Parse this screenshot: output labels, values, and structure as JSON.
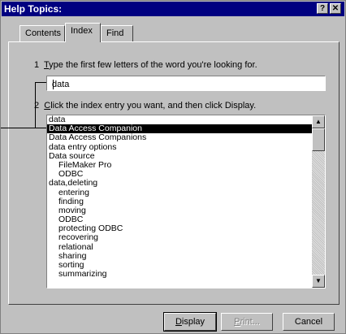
{
  "window": {
    "title": "Help Topics:"
  },
  "titlebar_buttons": {
    "help": "?",
    "close": "✕"
  },
  "tabs": [
    {
      "label": "Contents"
    },
    {
      "label": "Index"
    },
    {
      "label": "Find"
    }
  ],
  "step1": {
    "number": "1",
    "underlined_char": "T",
    "rest": "ype the first few letters of the word you're looking for."
  },
  "search": {
    "value": "data"
  },
  "step2": {
    "number": "2",
    "underlined_char": "C",
    "rest": "lick the index entry you want, and then click Display."
  },
  "index_list": [
    {
      "text": "data",
      "sub": false,
      "selected": false
    },
    {
      "text": "Data Access Companion",
      "sub": false,
      "selected": true
    },
    {
      "text": "Data Access Companions",
      "sub": false,
      "selected": false
    },
    {
      "text": "data entry options",
      "sub": false,
      "selected": false
    },
    {
      "text": "Data source",
      "sub": false,
      "selected": false
    },
    {
      "text": "FileMaker Pro",
      "sub": true,
      "selected": false
    },
    {
      "text": "ODBC",
      "sub": true,
      "selected": false
    },
    {
      "text": "data,deleting",
      "sub": false,
      "selected": false
    },
    {
      "text": "entering",
      "sub": true,
      "selected": false
    },
    {
      "text": "finding",
      "sub": true,
      "selected": false
    },
    {
      "text": "moving",
      "sub": true,
      "selected": false
    },
    {
      "text": "ODBC",
      "sub": true,
      "selected": false
    },
    {
      "text": "protecting ODBC",
      "sub": true,
      "selected": false
    },
    {
      "text": "recovering",
      "sub": true,
      "selected": false
    },
    {
      "text": "relational",
      "sub": true,
      "selected": false
    },
    {
      "text": "sharing",
      "sub": true,
      "selected": false
    },
    {
      "text": "sorting",
      "sub": true,
      "selected": false
    },
    {
      "text": "summarizing",
      "sub": true,
      "selected": false
    }
  ],
  "buttons": {
    "display": {
      "underlined_char": "D",
      "rest": "isplay"
    },
    "print": {
      "underlined_char": "P",
      "rest": "rint..."
    },
    "cancel": "Cancel"
  },
  "icons": {
    "scroll_up": "scroll-up-arrow-icon",
    "scroll_down": "scroll-down-arrow-icon"
  },
  "colors": {
    "titlebar": "#000080",
    "selection": "#000000",
    "face": "#c0c0c0"
  }
}
